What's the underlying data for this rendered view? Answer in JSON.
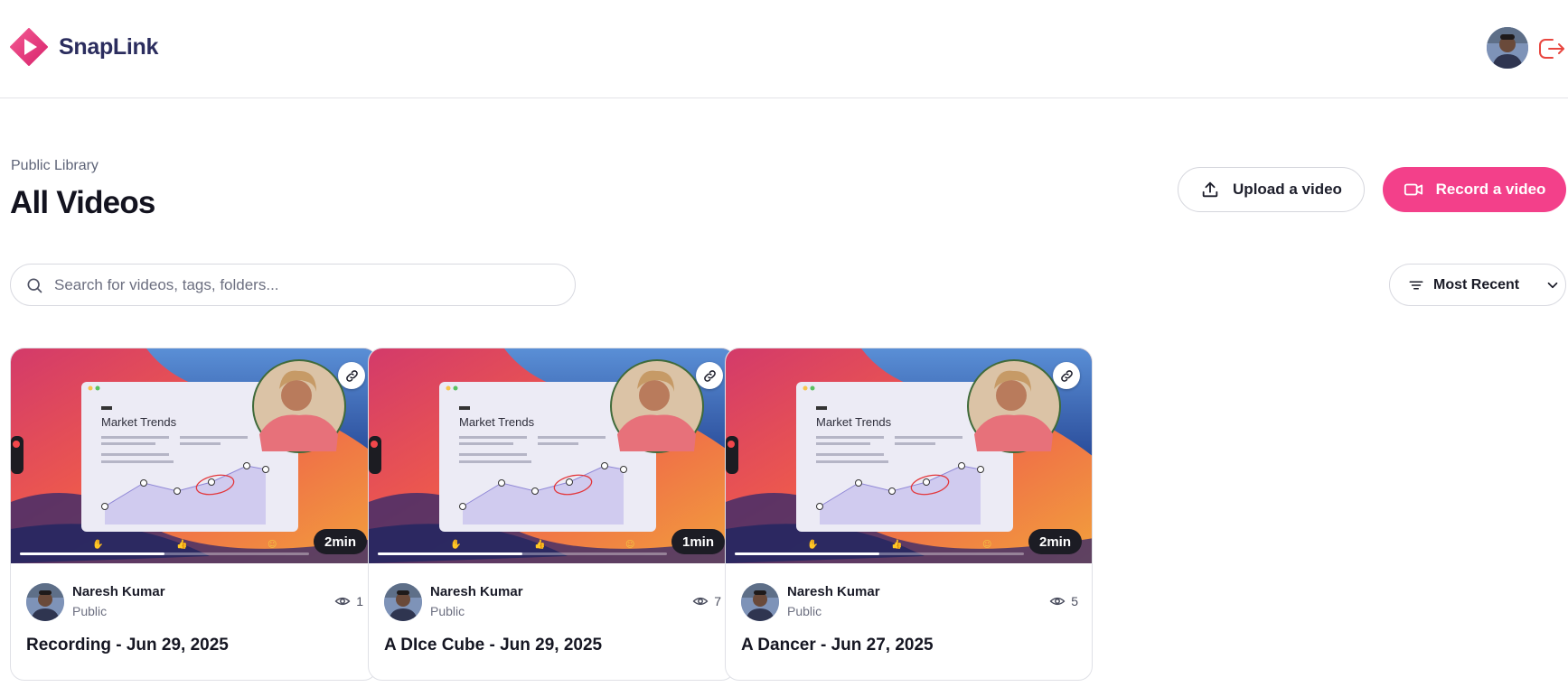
{
  "app": {
    "name": "SnapLink",
    "brand_color": "#f3408a"
  },
  "header": {
    "avatar_icon": "user-avatar",
    "logout_icon": "logout-icon"
  },
  "page": {
    "breadcrumb": "Public Library",
    "title": "All Videos"
  },
  "actions": {
    "upload_label": "Upload a video",
    "record_label": "Record a video"
  },
  "search": {
    "placeholder": "Search for videos, tags, folders...",
    "value": ""
  },
  "sort": {
    "label": "Most Recent"
  },
  "videos": [
    {
      "title": "Recording - Jun 29, 2025",
      "author": "Naresh Kumar",
      "visibility": "Public",
      "views": "1",
      "duration": "2min",
      "progress": 0.5,
      "thumb_title": "Market Trends"
    },
    {
      "title": "A DIce Cube - Jun 29, 2025",
      "author": "Naresh Kumar",
      "visibility": "Public",
      "views": "7",
      "duration": "1min",
      "progress": 0.5,
      "thumb_title": "Market Trends"
    },
    {
      "title": "A Dancer - Jun 27, 2025",
      "author": "Naresh Kumar",
      "visibility": "Public",
      "views": "5",
      "duration": "2min",
      "progress": 0.5,
      "thumb_title": "Market Trends"
    }
  ]
}
